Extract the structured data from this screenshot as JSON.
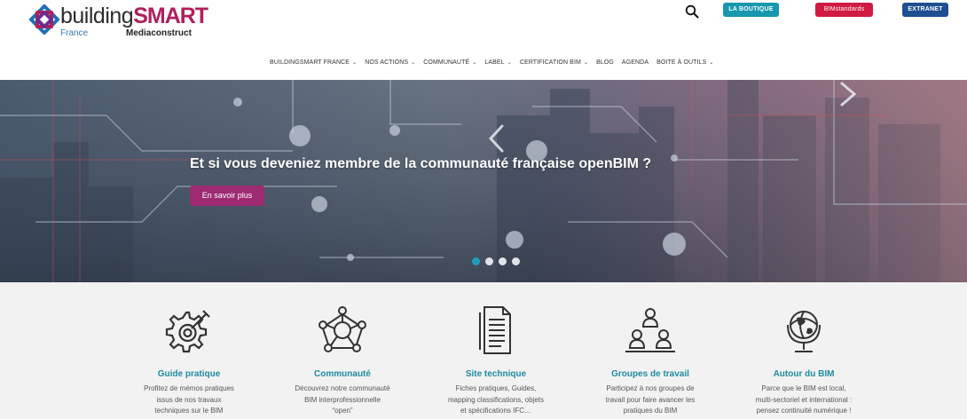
{
  "logo": {
    "brand_main": "building",
    "brand_accent": "SMART",
    "country": "France",
    "partner": "Mediaconstruct"
  },
  "header": {
    "buttons": [
      {
        "label": "LA BOUTIQUE",
        "color": "#1698ae"
      },
      {
        "label": "BIMstandards",
        "color": "#d01a43"
      },
      {
        "label": "EXTRANET",
        "color": "#1d4f91"
      }
    ]
  },
  "nav": {
    "items": [
      {
        "label": "BUILDINGSMART FRANCE",
        "has_submenu": true
      },
      {
        "label": "NOS ACTIONS",
        "has_submenu": true
      },
      {
        "label": "COMMUNAUTÉ",
        "has_submenu": true
      },
      {
        "label": "LABEL",
        "has_submenu": true
      },
      {
        "label": "CERTIFICATION BIM",
        "has_submenu": true
      },
      {
        "label": "BLOG",
        "has_submenu": false
      },
      {
        "label": "AGENDA",
        "has_submenu": false
      },
      {
        "label": "BOITE À OUTILS",
        "has_submenu": true
      }
    ],
    "chevron": "⌄"
  },
  "hero": {
    "title": "Et si vous deveniez membre de la communauté française openBIM ?",
    "cta": "En savoir plus",
    "cta_color": "#9e2a72",
    "slides": 4,
    "active_slide": 1
  },
  "features": [
    {
      "icon": "gear-target-icon",
      "title": "Guide pratique",
      "desc": "Profitez de mémos pratiques\nissus de nos travaux\ntechniques sur le BIM"
    },
    {
      "icon": "network-icon",
      "title": "Communauté",
      "desc": "Découvrez notre communauté\nBIM interprofessionnelle\n“open”"
    },
    {
      "icon": "document-icon",
      "title": "Site technique",
      "desc": "Fiches pratiques, Guides,\nmapping classifications, objets\net spécifications IFC…"
    },
    {
      "icon": "group-icon",
      "title": "Groupes de travail",
      "desc": "Participez à nos groupes de\ntravail pour faire avancer les\npratiques du BIM"
    },
    {
      "icon": "globe-icon",
      "title": "Autour du BIM",
      "desc": "Parce que le BIM est local,\nmulti-sectoriel et international :\npensez continuité numérique !"
    }
  ],
  "colors": {
    "accent_teal": "#1f8ba0",
    "accent_magenta": "#b01f5c"
  }
}
